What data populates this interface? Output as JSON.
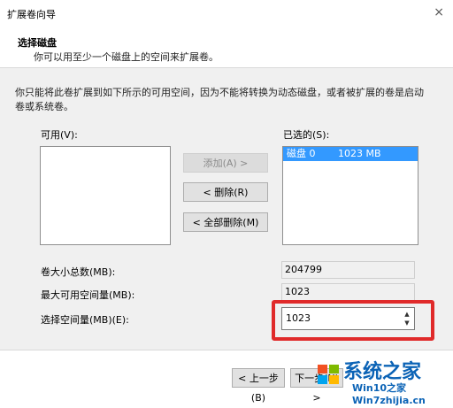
{
  "window": {
    "title": "扩展卷向导",
    "close_glyph": "×"
  },
  "header": {
    "title": "选择磁盘",
    "subtitle": "你可以用至少一个磁盘上的空间来扩展卷。"
  },
  "description": "你只能将此卷扩展到如下所示的可用空间，因为不能将转换为动态磁盘，或者被扩展的卷是启动卷或系统卷。",
  "available": {
    "label": "可用(V):"
  },
  "selected": {
    "label": "已选的(S):",
    "items": [
      {
        "disk": "磁盘 0",
        "size": "1023 MB"
      }
    ]
  },
  "buttons": {
    "add": "添加(A) >",
    "remove": "< 删除(R)",
    "remove_all": "< 全部删除(M)",
    "back": "< 上一步(B)",
    "next": "下一步(N) >"
  },
  "fields": {
    "total_label": "卷大小总数(MB):",
    "total_value": "204799",
    "max_label": "最大可用空间量(MB):",
    "max_value": "1023",
    "select_label": "选择空间量(MB)(E):",
    "select_value": "1023"
  },
  "watermark": {
    "brand": "系统之家",
    "url": "Win10之家 Win7zhijia.cn"
  },
  "colors": {
    "highlight": "#3399ff",
    "red_box": "#e02a2a",
    "brand": "#0b63b6"
  }
}
